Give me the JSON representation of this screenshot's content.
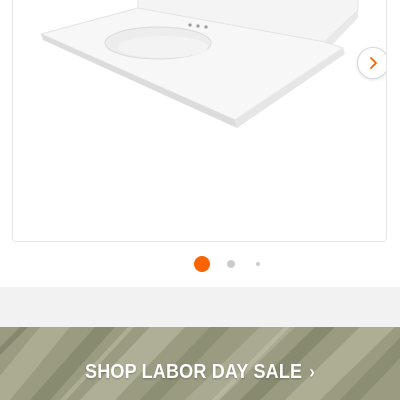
{
  "carousel": {
    "slide_count": 3,
    "active_slide": 1,
    "next_icon": "chevron-right-icon",
    "product_image": "vanity-top-with-integrated-oval-sink"
  },
  "promo_banner": {
    "label": "SHOP LABOR DAY SALE",
    "chevron": "›",
    "text_color": "#ffffff"
  },
  "colors": {
    "active_dot": "#f96302",
    "inactive_dot": "#cccccc",
    "divider_band": "#f2f2f2",
    "banner_base": "#9a9b80"
  }
}
